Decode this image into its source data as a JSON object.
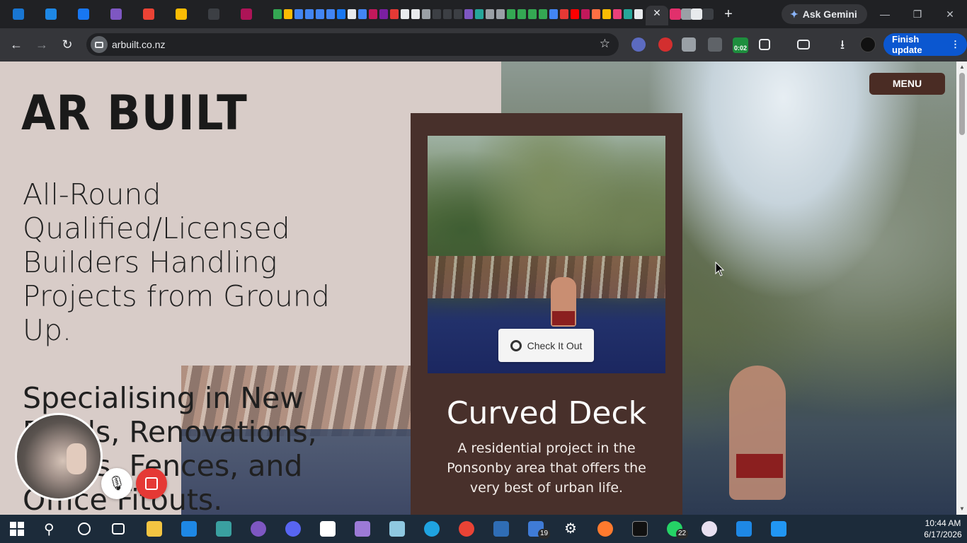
{
  "browser": {
    "active_tab_close": "✕",
    "new_tab": "+",
    "gemini_label": "Ask Gemini",
    "url": "arbuilt.co.nz",
    "timer": "0:02",
    "finish_update_label": "Finish update",
    "window_controls": [
      "—",
      "❐",
      "✕"
    ]
  },
  "page": {
    "logo": "AR BUILT",
    "tagline": "All-Round Qualified/Licensed Builders Handling Projects from Ground Up.",
    "speciality": "Specialising in New Builds, Renovations, Decks, Fences, and Office Fitouts.",
    "menu_label": "MENU",
    "card": {
      "button_label": "Check It Out",
      "title": "Curved Deck",
      "description": "A residential project in the Ponsonby area that offers the very best of urban life."
    }
  },
  "recorder": {
    "mic_icon": "🎙"
  },
  "taskbar": {
    "badges": {
      "teams": "19",
      "whatsapp": "22"
    },
    "clock_time": "10:44 AM",
    "clock_date": "6/17/2026"
  },
  "colors": {
    "page_bg": "#d8ccc8",
    "card_bg": "#48302b",
    "menu_bg": "#4a2c24",
    "browser_accent": "#0b57d0",
    "stop_red": "#e53935"
  }
}
